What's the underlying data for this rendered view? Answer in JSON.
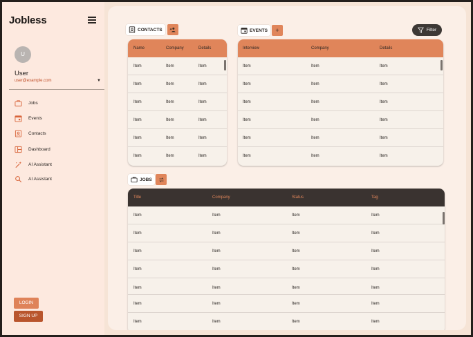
{
  "app": {
    "title": "Jobless"
  },
  "user": {
    "avatar_initial": "U",
    "name": "User",
    "email": "user@example.com"
  },
  "nav": {
    "items": [
      {
        "label": "Jobs",
        "icon": "briefcase-icon"
      },
      {
        "label": "Events",
        "icon": "calendar-icon"
      },
      {
        "label": "Contacts",
        "icon": "contact-card-icon"
      },
      {
        "label": "Dashboard",
        "icon": "dashboard-icon"
      },
      {
        "label": "AI Assistant",
        "icon": "magic-wand-icon"
      },
      {
        "label": "AI Assistant",
        "icon": "search-icon"
      }
    ]
  },
  "auth": {
    "login_label": "LOGIN",
    "signup_label": "SIGN UP"
  },
  "contacts": {
    "chip_label": "CONTACTS",
    "add_icon": "add-person-icon",
    "columns": [
      "Name",
      "Company",
      "Details"
    ],
    "rows": [
      [
        "Item",
        "Item",
        "Item"
      ],
      [
        "Item",
        "Item",
        "Item"
      ],
      [
        "Item",
        "Item",
        "Item"
      ],
      [
        "Item",
        "Item",
        "Item"
      ],
      [
        "Item",
        "Item",
        "Item"
      ],
      [
        "Item",
        "Item",
        "Item"
      ]
    ]
  },
  "events": {
    "chip_label": "EVENTS",
    "add_label": "+",
    "columns": [
      "Interview",
      "Company",
      "Details"
    ],
    "rows": [
      [
        "Item",
        "Item",
        "Item"
      ],
      [
        "Item",
        "Item",
        "Item"
      ],
      [
        "Item",
        "Item",
        "Item"
      ],
      [
        "Item",
        "Item",
        "Item"
      ],
      [
        "Item",
        "Item",
        "Item"
      ],
      [
        "Item",
        "Item",
        "Item"
      ]
    ]
  },
  "filter": {
    "label": "Filter"
  },
  "jobs": {
    "chip_label": "JOBS",
    "action_icon": "swap-icon",
    "columns": [
      "Title",
      "Company",
      "Status",
      "Tag"
    ],
    "rows": [
      [
        "Item",
        "Item",
        "Item",
        "Item"
      ],
      [
        "Item",
        "Item",
        "Item",
        "Item"
      ],
      [
        "Item",
        "Item",
        "Item",
        "Item"
      ],
      [
        "Item",
        "Item",
        "Item",
        "Item"
      ],
      [
        "Item",
        "Item",
        "Item",
        "Item"
      ],
      [
        "Item",
        "Item",
        "Item",
        "Item"
      ],
      [
        "Item",
        "Item",
        "Item",
        "Item"
      ]
    ]
  },
  "colors": {
    "accent": "#e0855a",
    "dark": "#3a3330",
    "sidebar": "#fde9df",
    "background": "#f6e4d6"
  }
}
